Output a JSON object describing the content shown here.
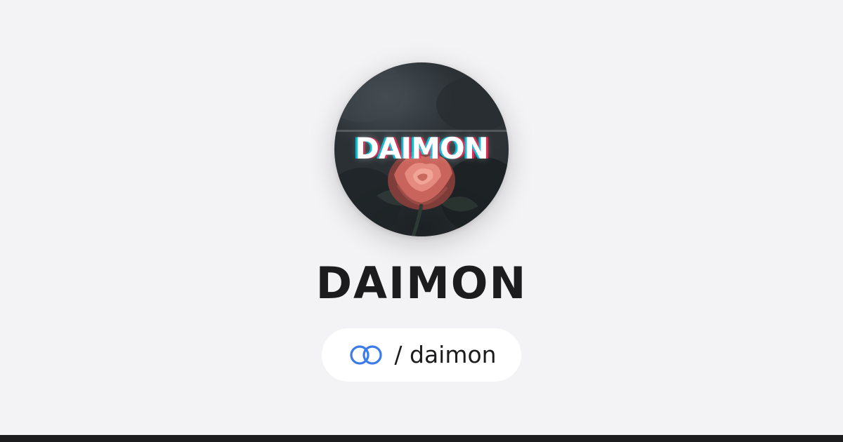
{
  "avatar": {
    "logo_text": "DAIMON",
    "icon": "profile-avatar-rose-glitch-logo"
  },
  "profile": {
    "name": "DAIMON",
    "handle": "/ daimon",
    "link_icon": "link-rings-icon"
  },
  "colors": {
    "background": "#f3f3f5",
    "text": "#1c1c1e",
    "accent": "#3d7be8",
    "pill": "#ffffff",
    "bottom_bar": "#1c1c1e"
  }
}
